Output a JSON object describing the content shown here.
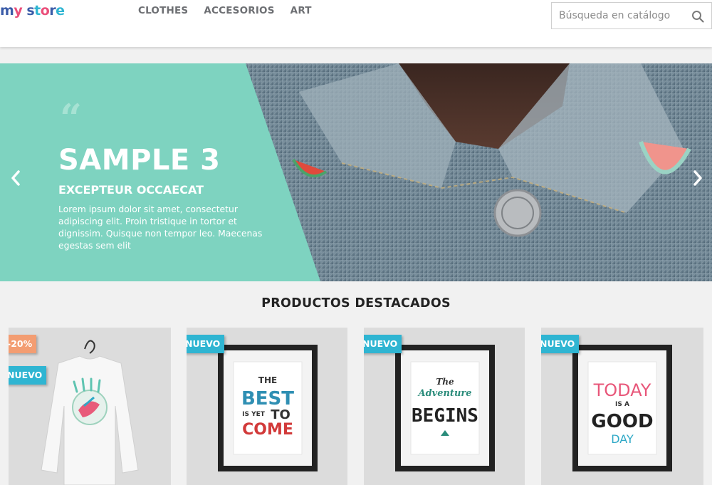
{
  "logo": {
    "text": "my store"
  },
  "nav": {
    "items": [
      "CLOTHES",
      "ACCESORIOS",
      "ART"
    ]
  },
  "search": {
    "placeholder": "Búsqueda en catálogo"
  },
  "slider": {
    "title": "SAMPLE 3",
    "subtitle": "EXCEPTEUR OCCAECAT",
    "text": "Lorem ipsum dolor sit amet, consectetur adipiscing elit. Proin tristique in tortor et dignissim. Quisque non tempor leo. Maecenas egestas sem elit"
  },
  "featured": {
    "title": "PRODUCTOS DESTACADOS",
    "products": [
      {
        "image": "hummingbird-sweater",
        "badges": {
          "discount": "-20%",
          "new": "NUEVO"
        }
      },
      {
        "image": "poster-the-best-is-yet-to-come",
        "badges": {
          "new": "NUEVO"
        },
        "poster": [
          "THE",
          "BEST",
          "IS YET",
          "TO",
          "COME"
        ]
      },
      {
        "image": "poster-the-adventure-begins",
        "badges": {
          "new": "NUEVO"
        },
        "poster": [
          "The",
          "Adventure",
          "BEGINS"
        ]
      },
      {
        "image": "poster-today-is-a-good-day",
        "badges": {
          "new": "NUEVO"
        },
        "poster": [
          "TODAY",
          "IS A",
          "GOOD",
          "DAY"
        ]
      }
    ]
  },
  "colors": {
    "accent": "#2fb5d2",
    "discount": "#f39d72",
    "slide_panel": "#7ed3c0",
    "nav_text": "#6d6f73"
  }
}
